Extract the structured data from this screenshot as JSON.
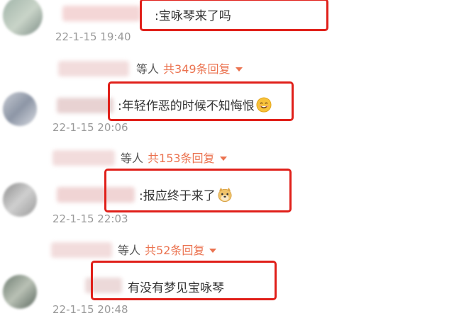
{
  "comments": [
    {
      "text": ":宝咏琴来了吗",
      "time": "22-1-15 19:40",
      "reply_people": "等人",
      "reply_count": "共349条回复"
    },
    {
      "text": ":年轻作恶的时候不知悔恨",
      "emoji": "smile-emoji",
      "time": "22-1-15 20:06",
      "reply_people": "等人",
      "reply_count": "共153条回复"
    },
    {
      "text": ":报应终于来了",
      "emoji": "doge-emoji",
      "time": "22-1-15 22:03",
      "reply_people": "等人",
      "reply_count": "共52条回复"
    },
    {
      "text": "有没有梦见宝咏琴",
      "time": "22-1-15 20:48"
    }
  ],
  "colors": {
    "highlight_box": "#e0201a",
    "reply_link": "#eb7350",
    "timestamp": "#9a9a9a"
  }
}
